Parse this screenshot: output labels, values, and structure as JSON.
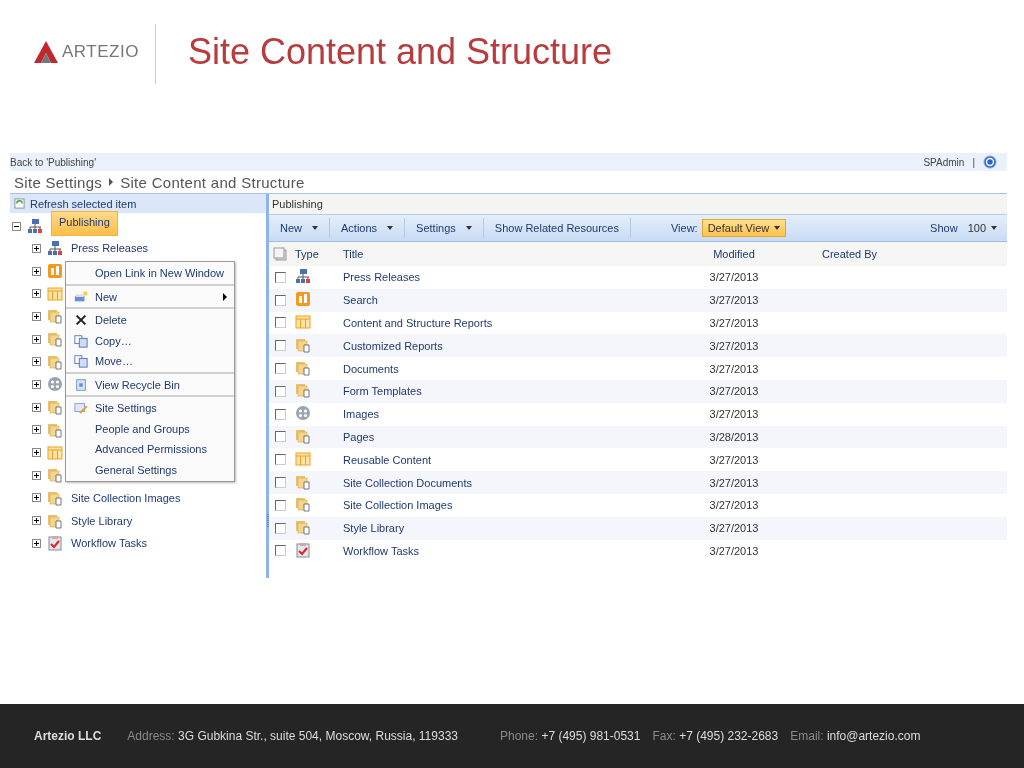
{
  "slide": {
    "logo": "ARTEZIO",
    "title": "Site Content and Structure"
  },
  "top_bar": {
    "back_link": "Back to 'Publishing'",
    "user": "SPAdmin",
    "separator": "|"
  },
  "breadcrumb": [
    "Site Settings",
    "Site Content and Structure"
  ],
  "tree": {
    "refresh": "Refresh selected item",
    "root": {
      "label": "Publishing",
      "kind": "site",
      "expanded": true,
      "selected": true,
      "children": [
        {
          "label": "Press Releases",
          "kind": "site"
        },
        {
          "kind": "search"
        },
        {
          "kind": "table"
        },
        {
          "kind": "folder"
        },
        {
          "kind": "folder"
        },
        {
          "kind": "folder"
        },
        {
          "kind": "images"
        },
        {
          "kind": "folder"
        },
        {
          "kind": "folder"
        },
        {
          "kind": "table"
        },
        {
          "kind": "folder"
        },
        {
          "label": "Site Collection Images",
          "kind": "folder"
        },
        {
          "label": "Style Library",
          "kind": "folder"
        },
        {
          "label": "Workflow Tasks",
          "kind": "tasks"
        }
      ]
    }
  },
  "context_menu": [
    {
      "label": "Open Link in New Window",
      "kind": "none",
      "submenu": false,
      "divider_after": true
    },
    {
      "label": "New",
      "kind": "new",
      "submenu": true,
      "divider_after": true
    },
    {
      "label": "Delete",
      "kind": "delete",
      "submenu": false,
      "divider_after": false
    },
    {
      "label": "Copy…",
      "kind": "copy",
      "submenu": false,
      "divider_after": false
    },
    {
      "label": "Move…",
      "kind": "copy",
      "submenu": false,
      "divider_after": true
    },
    {
      "label": "View Recycle Bin",
      "kind": "recycle",
      "submenu": false,
      "divider_after": true
    },
    {
      "label": "Site Settings",
      "kind": "settings",
      "submenu": false,
      "divider_after": false
    },
    {
      "label": "People and Groups",
      "kind": "none",
      "submenu": false,
      "divider_after": false
    },
    {
      "label": "Advanced Permissions",
      "kind": "none",
      "submenu": false,
      "divider_after": false
    },
    {
      "label": "General Settings",
      "kind": "none",
      "submenu": false,
      "divider_after": false
    }
  ],
  "list": {
    "path": "Publishing",
    "toolbar": [
      {
        "label": "New",
        "dropdown": true
      },
      {
        "label": "Actions",
        "dropdown": true
      },
      {
        "label": "Settings",
        "dropdown": true
      },
      {
        "label": "Show Related Resources",
        "dropdown": false
      }
    ],
    "view_label": "View:",
    "view": "Default View",
    "show_label": "Show",
    "show_count": "100",
    "columns": [
      "Type",
      "Title",
      "Modified",
      "Created By"
    ],
    "rows": [
      {
        "kind": "site",
        "title": "Press Releases",
        "modified": "3/27/2013",
        "checked": false
      },
      {
        "kind": "search",
        "title": "Search",
        "modified": "3/27/2013",
        "checked": false
      },
      {
        "kind": "table",
        "title": "Content and Structure Reports",
        "modified": "3/27/2013",
        "checked": false
      },
      {
        "kind": "folder",
        "title": "Customized Reports",
        "modified": "3/27/2013",
        "checked": false
      },
      {
        "kind": "folder",
        "title": "Documents",
        "modified": "3/27/2013",
        "checked": false
      },
      {
        "kind": "folder",
        "title": "Form Templates",
        "modified": "3/27/2013",
        "checked": false
      },
      {
        "kind": "images",
        "title": "Images",
        "modified": "3/27/2013",
        "checked": false
      },
      {
        "kind": "folder",
        "title": "Pages",
        "modified": "3/28/2013",
        "checked": false
      },
      {
        "kind": "table",
        "title": "Reusable Content",
        "modified": "3/27/2013",
        "checked": false
      },
      {
        "kind": "folder",
        "title": "Site Collection Documents",
        "modified": "3/27/2013",
        "checked": false
      },
      {
        "kind": "folder",
        "title": "Site Collection Images",
        "modified": "3/27/2013",
        "checked": false
      },
      {
        "kind": "folder",
        "title": "Style Library",
        "modified": "3/27/2013",
        "checked": false
      },
      {
        "kind": "tasks",
        "title": "Workflow Tasks",
        "modified": "3/27/2013",
        "checked": false
      }
    ]
  },
  "footer": {
    "company": "Artezio LLC",
    "items": [
      {
        "label": "Address:",
        "value": "3G Gubkina Str., suite 504, Moscow, Russia, 119333"
      },
      {
        "label": "Phone:",
        "value": "+7 (495) 981-0531"
      },
      {
        "label": "Fax:",
        "value": "+7 (495) 232-2683"
      },
      {
        "label": "Email:",
        "value": "info@artezio.com"
      }
    ]
  }
}
